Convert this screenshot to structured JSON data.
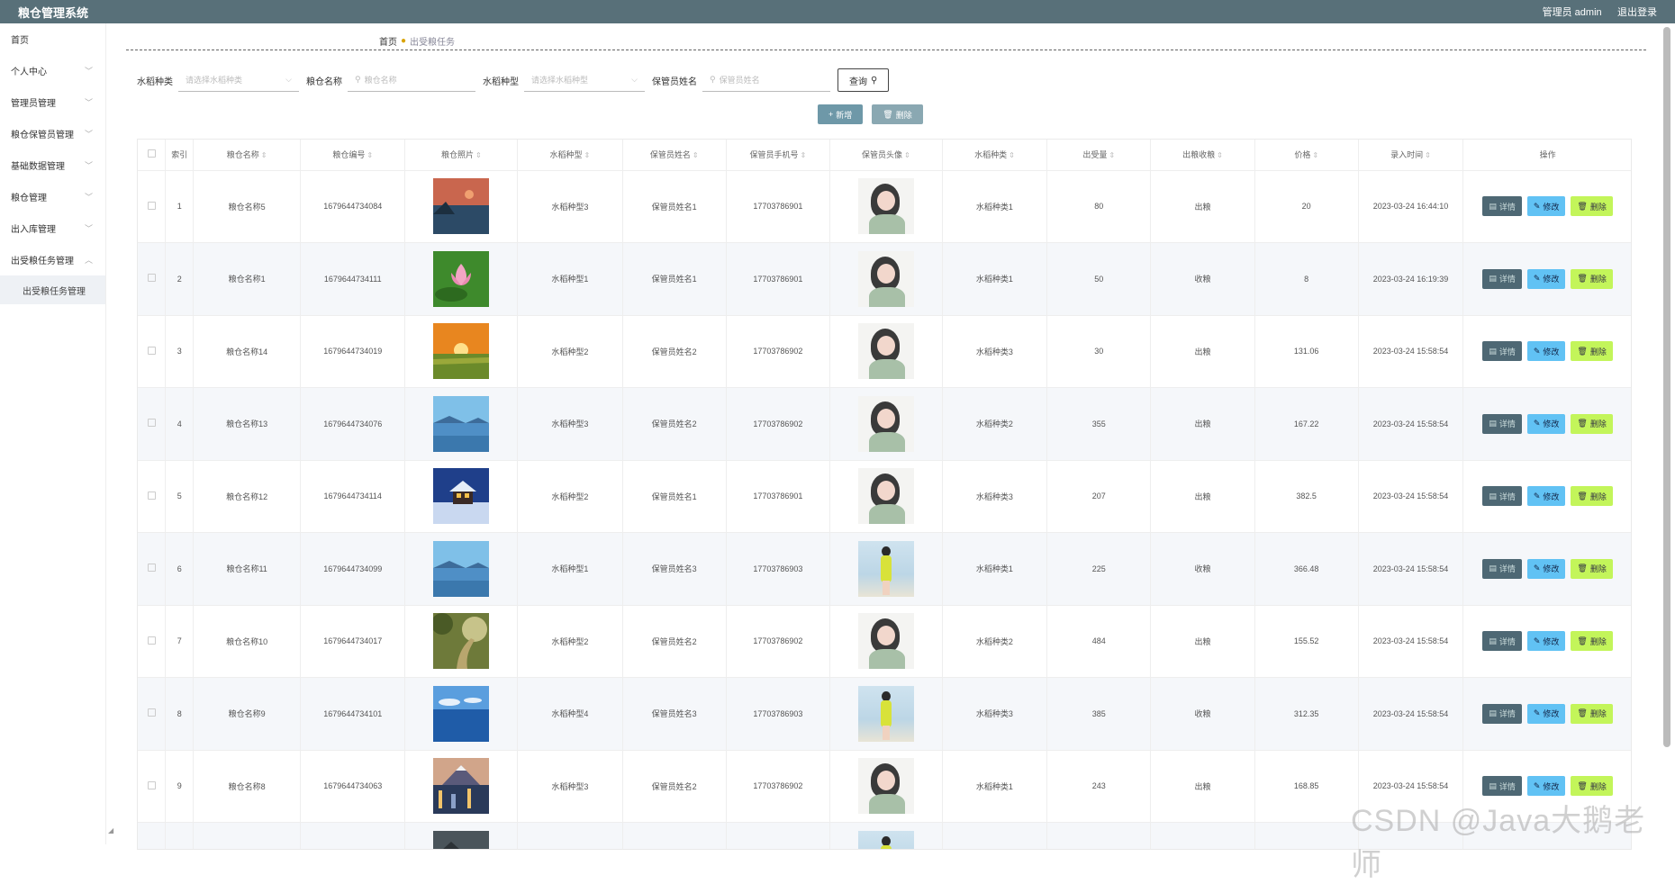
{
  "app": {
    "title": "粮仓管理系统",
    "user_label": "管理员 admin",
    "logout_label": "退出登录"
  },
  "sidebar": {
    "items": [
      {
        "label": "首页",
        "has_children": false
      },
      {
        "label": "个人中心",
        "has_children": true
      },
      {
        "label": "管理员管理",
        "has_children": true
      },
      {
        "label": "粮仓保管员管理",
        "has_children": true
      },
      {
        "label": "基础数据管理",
        "has_children": true
      },
      {
        "label": "粮仓管理",
        "has_children": true
      },
      {
        "label": "出入库管理",
        "has_children": true
      },
      {
        "label": "出受粮任务管理",
        "has_children": true,
        "expanded": true
      }
    ],
    "active_sub": "出受粮任务管理"
  },
  "breadcrumb": {
    "home": "首页",
    "current": "出受粮任务"
  },
  "search": {
    "f1_label": "水稻种类",
    "f1_placeholder": "请选择水稻种类",
    "f2_label": "粮仓名称",
    "f2_placeholder": "粮仓名称",
    "f3_label": "水稻种型",
    "f3_placeholder": "请选择水稻种型",
    "f4_label": "保管员姓名",
    "f4_placeholder": "保管员姓名",
    "query_label": "查询"
  },
  "ops": {
    "add_label": "新增",
    "delete_label": "删除"
  },
  "table": {
    "headers": [
      "索引",
      "粮仓名称",
      "粮仓编号",
      "粮仓照片",
      "水稻种型",
      "保管员姓名",
      "保管员手机号",
      "保管员头像",
      "水稻种类",
      "出受量",
      "出粮收粮",
      "价格",
      "录入时间",
      "操作"
    ],
    "actions": {
      "detail": "详情",
      "edit": "修改",
      "delete": "删除"
    },
    "rows": [
      {
        "idx": "1",
        "name": "粮仓名称5",
        "code": "1679644734084",
        "photo": "sunset-lake",
        "model": "水稻种型3",
        "keeper": "保管员姓名1",
        "phone": "17703786901",
        "avatar": "girl",
        "kind": "水稻种类1",
        "qty": "80",
        "io": "出粮",
        "price": "20",
        "time": "2023-03-24 16:44:10"
      },
      {
        "idx": "2",
        "name": "粮仓名称1",
        "code": "1679644734111",
        "photo": "lotus",
        "model": "水稻种型1",
        "keeper": "保管员姓名1",
        "phone": "17703786901",
        "avatar": "girl",
        "kind": "水稻种类1",
        "qty": "50",
        "io": "收粮",
        "price": "8",
        "time": "2023-03-24 16:19:39"
      },
      {
        "idx": "3",
        "name": "粮仓名称14",
        "code": "1679644734019",
        "photo": "sunrise-field",
        "model": "水稻种型2",
        "keeper": "保管员姓名2",
        "phone": "17703786902",
        "avatar": "girl",
        "kind": "水稻种类3",
        "qty": "30",
        "io": "出粮",
        "price": "131.06",
        "time": "2023-03-24 15:58:54"
      },
      {
        "idx": "4",
        "name": "粮仓名称13",
        "code": "1679644734076",
        "photo": "blue-lake",
        "model": "水稻种型3",
        "keeper": "保管员姓名2",
        "phone": "17703786902",
        "avatar": "girl",
        "kind": "水稻种类2",
        "qty": "355",
        "io": "出粮",
        "price": "167.22",
        "time": "2023-03-24 15:58:54"
      },
      {
        "idx": "5",
        "name": "粮仓名称12",
        "code": "1679644734114",
        "photo": "snow-cabin",
        "model": "水稻种型2",
        "keeper": "保管员姓名1",
        "phone": "17703786901",
        "avatar": "girl",
        "kind": "水稻种类3",
        "qty": "207",
        "io": "出粮",
        "price": "382.5",
        "time": "2023-03-24 15:58:54"
      },
      {
        "idx": "6",
        "name": "粮仓名称11",
        "code": "1679644734099",
        "photo": "blue-lake",
        "model": "水稻种型1",
        "keeper": "保管员姓名3",
        "phone": "17703786903",
        "avatar": "beach-girl",
        "kind": "水稻种类1",
        "qty": "225",
        "io": "收粮",
        "price": "366.48",
        "time": "2023-03-24 15:58:54"
      },
      {
        "idx": "7",
        "name": "粮仓名称10",
        "code": "1679644734017",
        "photo": "forest-path",
        "model": "水稻种型2",
        "keeper": "保管员姓名2",
        "phone": "17703786902",
        "avatar": "girl",
        "kind": "水稻种类2",
        "qty": "484",
        "io": "出粮",
        "price": "155.52",
        "time": "2023-03-24 15:58:54"
      },
      {
        "idx": "8",
        "name": "粮仓名称9",
        "code": "1679644734101",
        "photo": "ocean",
        "model": "水稻种型4",
        "keeper": "保管员姓名3",
        "phone": "17703786903",
        "avatar": "beach-girl",
        "kind": "水稻种类3",
        "qty": "385",
        "io": "收粮",
        "price": "312.35",
        "time": "2023-03-24 15:58:54"
      },
      {
        "idx": "9",
        "name": "粮仓名称8",
        "code": "1679644734063",
        "photo": "city-mountain",
        "model": "水稻种型3",
        "keeper": "保管员姓名2",
        "phone": "17703786902",
        "avatar": "girl",
        "kind": "水稻种类1",
        "qty": "243",
        "io": "出粮",
        "price": "168.85",
        "time": "2023-03-24 15:58:54"
      },
      {
        "idx": "",
        "name": "",
        "code": "",
        "photo": "dark-mountain",
        "model": "",
        "keeper": "",
        "phone": "",
        "avatar": "beach-girl",
        "kind": "",
        "qty": "",
        "io": "",
        "price": "",
        "time": ""
      }
    ]
  },
  "watermark": "CSDN @Java大鹅老师",
  "colors": {
    "topbar": "#587079",
    "detail_btn": "#4e6874",
    "edit_btn": "#61c2f4",
    "delete_btn": "#c3f55a",
    "add_btn": "#6e98a8"
  }
}
